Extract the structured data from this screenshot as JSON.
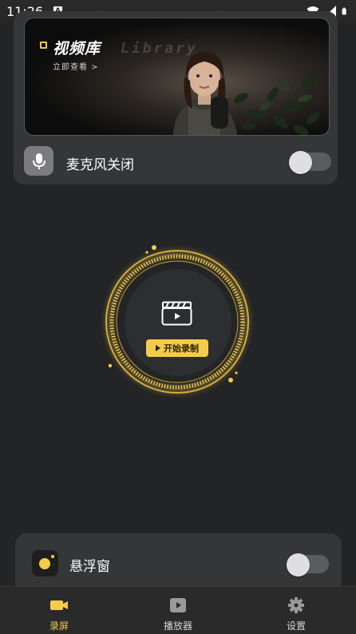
{
  "status_bar": {
    "time": "11:26",
    "notification_letter": "A",
    "icons": [
      "wifi-icon",
      "signal-icon",
      "battery-icon"
    ]
  },
  "library_banner": {
    "title": "视频库",
    "background_word": "Library",
    "link_text": "立即查看 >"
  },
  "microphone": {
    "label": "麦克风关闭",
    "enabled": false
  },
  "record": {
    "button_label": "开始录制"
  },
  "floating_window": {
    "label": "悬浮窗",
    "enabled": false
  },
  "bottom_nav": {
    "items": [
      {
        "label": "录屏",
        "icon": "camera-icon",
        "active": true
      },
      {
        "label": "播放器",
        "icon": "play-icon",
        "active": false
      },
      {
        "label": "设置",
        "icon": "gear-icon",
        "active": false
      }
    ]
  },
  "colors": {
    "accent": "#f4cc4a",
    "background": "#232426",
    "card": "#353638"
  }
}
